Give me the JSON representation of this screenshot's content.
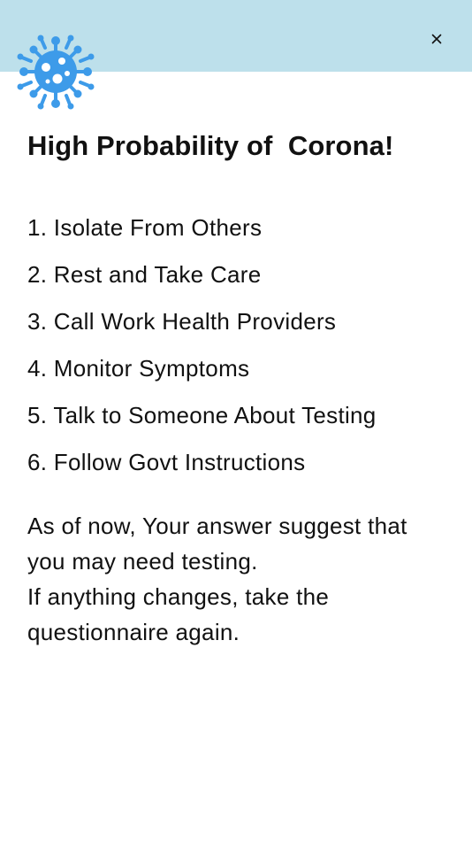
{
  "header": {
    "band_color": "#bde0eb",
    "close_icon": "close-icon",
    "logo_icon": "virus-icon",
    "logo_color": "#3d9be9"
  },
  "result": {
    "title": "High Probability of  Corona!"
  },
  "steps": [
    "1. Isolate From Others",
    "2. Rest and Take Care",
    "3. Call Work Health Providers",
    "4. Monitor Symptoms",
    "5. Talk to Someone About Testing",
    "6. Follow Govt Instructions"
  ],
  "message": {
    "line1": "As of now, Your answer suggest that you may need testing.",
    "line2": "If anything changes, take the questionnaire again."
  }
}
